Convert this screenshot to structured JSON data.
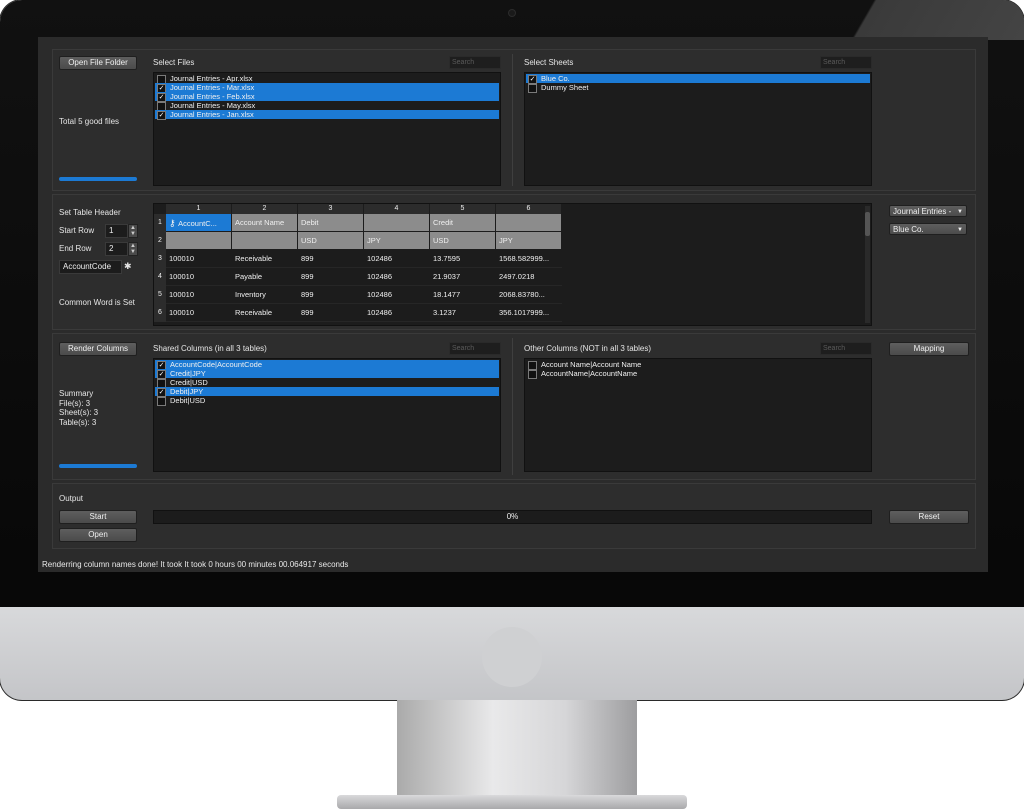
{
  "files": {
    "open_button": "Open File Folder",
    "section_label": "Select Files",
    "search_placeholder": "Search",
    "summary": "Total 5 good files",
    "progress": 1.0,
    "items": [
      {
        "label": "Journal Entries - Apr.xlsx",
        "checked": false,
        "selected": false
      },
      {
        "label": "Journal Entries - Mar.xlsx",
        "checked": true,
        "selected": true
      },
      {
        "label": "Journal Entries - Feb.xlsx",
        "checked": true,
        "selected": true
      },
      {
        "label": "Journal Entries - May.xlsx",
        "checked": false,
        "selected": false
      },
      {
        "label": "Journal Entries - Jan.xlsx",
        "checked": true,
        "selected": true
      }
    ]
  },
  "sheets": {
    "section_label": "Select Sheets",
    "search_placeholder": "Search",
    "items": [
      {
        "label": "Blue Co.",
        "checked": true,
        "selected": true
      },
      {
        "label": "Dummy Sheet",
        "checked": false,
        "selected": false
      }
    ]
  },
  "header": {
    "section_label": "Set Table Header",
    "start_row_label": "Start Row",
    "start_row_value": "1",
    "end_row_label": "End Row",
    "end_row_value": "2",
    "keyword_value": "AccountCode",
    "common_word_label": "Common Word is Set",
    "table_combo": "Journal Entries -",
    "sheet_combo": "Blue Co.",
    "col_headers": [
      "1",
      "2",
      "3",
      "4",
      "5",
      "6"
    ],
    "rows": [
      {
        "num": "1",
        "cells": [
          "AccountC...",
          "Account Name",
          "Debit",
          "",
          "Credit",
          ""
        ]
      },
      {
        "num": "2",
        "cells": [
          "",
          "",
          "USD",
          "JPY",
          "USD",
          "JPY"
        ]
      },
      {
        "num": "3",
        "cells": [
          "100010",
          "Receivable",
          "899",
          "102486",
          "13.7595",
          "1568.582999..."
        ]
      },
      {
        "num": "4",
        "cells": [
          "100010",
          "Payable",
          "899",
          "102486",
          "21.9037",
          "2497.0218"
        ]
      },
      {
        "num": "5",
        "cells": [
          "100010",
          "Inventory",
          "899",
          "102486",
          "18.1477",
          "2068.83780..."
        ]
      },
      {
        "num": "6",
        "cells": [
          "100010",
          "Receivable",
          "899",
          "102486",
          "3.1237",
          "356.1017999..."
        ]
      }
    ]
  },
  "columns": {
    "render_button": "Render Columns",
    "shared_label": "Shared Columns (in all 3 tables)",
    "other_label": "Other Columns (NOT in all 3 tables)",
    "search_placeholder": "Search",
    "mapping_button": "Mapping",
    "summary_title": "Summary",
    "summary_files": "File(s): 3",
    "summary_sheets": "Sheet(s): 3",
    "summary_tables": "Table(s): 3",
    "progress": 1.0,
    "shared_items": [
      {
        "label": "AccountCode|AccountCode",
        "checked": true,
        "selected": true
      },
      {
        "label": "Credit|JPY",
        "checked": true,
        "selected": true
      },
      {
        "label": "Credit|USD",
        "checked": false,
        "selected": false
      },
      {
        "label": "Debit|JPY",
        "checked": true,
        "selected": true
      },
      {
        "label": "Debit|USD",
        "checked": false,
        "selected": false
      }
    ],
    "other_items": [
      {
        "label": "Account Name|Account Name",
        "checked": false,
        "selected": false
      },
      {
        "label": "AccountName|AccountName",
        "checked": false,
        "selected": false
      }
    ]
  },
  "output": {
    "section_label": "Output",
    "start_button": "Start",
    "open_button": "Open",
    "reset_button": "Reset",
    "progress_text": "0%",
    "progress": 0
  },
  "status": {
    "message": "Renderring column names done! It took It took 0 hours 00 minutes 00.064917 seconds"
  },
  "colors": {
    "accent": "#1c7ad4",
    "header_cell": "#8c8c8c"
  }
}
